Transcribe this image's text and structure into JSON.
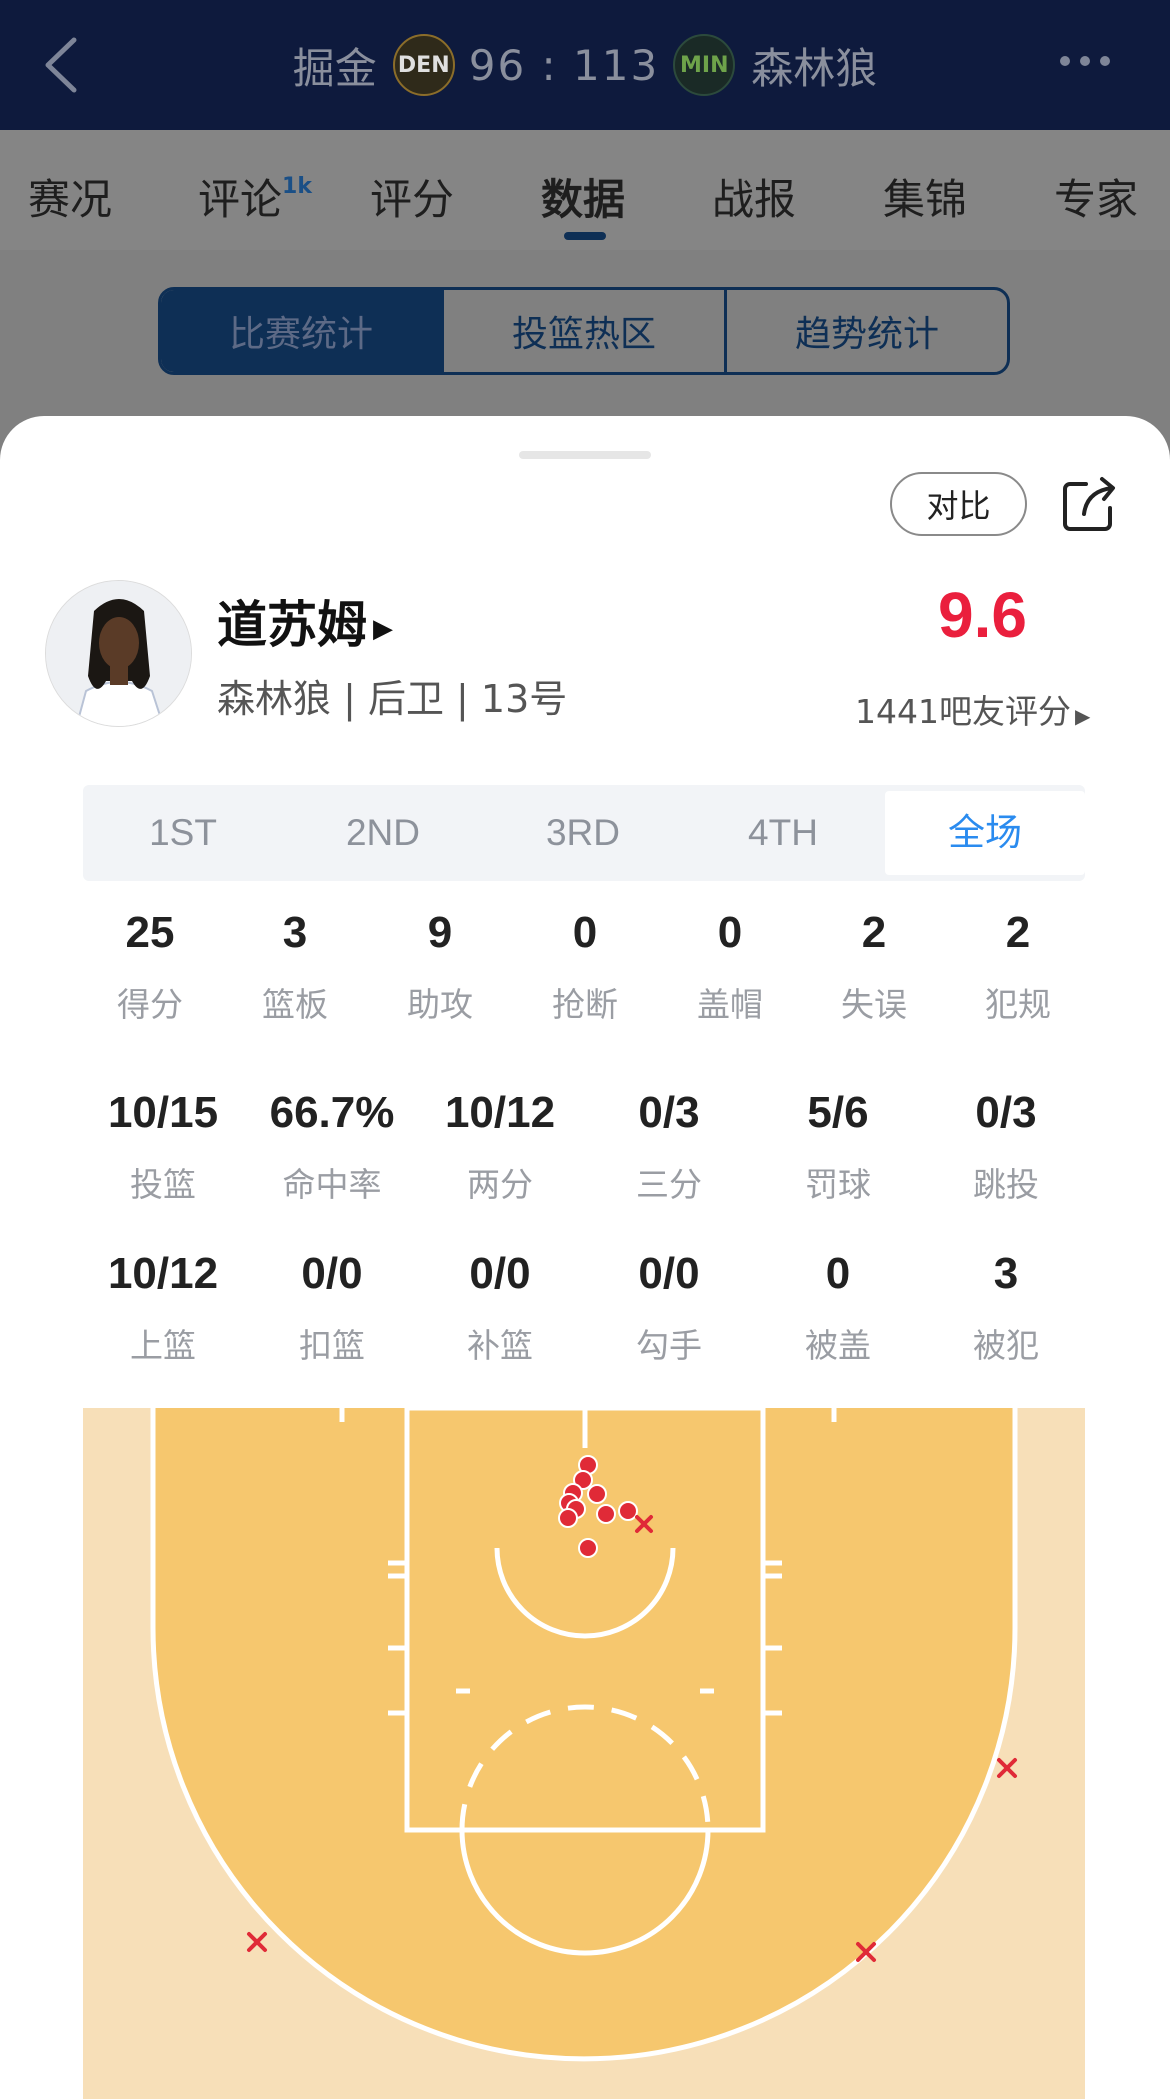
{
  "header": {
    "home_team": "掘金",
    "home_logo": "DEN",
    "score": "96 : 113",
    "away_logo": "MIN",
    "away_team": "森林狼"
  },
  "tabs": [
    {
      "label": "赛况"
    },
    {
      "label": "评论",
      "badge": "1k"
    },
    {
      "label": "评分"
    },
    {
      "label": "数据",
      "active": true
    },
    {
      "label": "战报"
    },
    {
      "label": "集锦"
    },
    {
      "label": "专家"
    }
  ],
  "segments": [
    "比赛统计",
    "投篮热区",
    "趋势统计"
  ],
  "sheet": {
    "compare_label": "对比",
    "player": {
      "name": "道苏姆",
      "info": "森林狼 | 后卫 | 13号",
      "rating": "9.6",
      "rating_count": "1441吧友评分"
    },
    "periods": [
      "1ST",
      "2ND",
      "3RD",
      "4TH",
      "全场"
    ],
    "active_period": "全场",
    "stats_row1": [
      {
        "value": "25",
        "label": "得分"
      },
      {
        "value": "3",
        "label": "篮板"
      },
      {
        "value": "9",
        "label": "助攻"
      },
      {
        "value": "0",
        "label": "抢断"
      },
      {
        "value": "0",
        "label": "盖帽"
      },
      {
        "value": "2",
        "label": "失误"
      },
      {
        "value": "2",
        "label": "犯规"
      }
    ],
    "stats_row2": [
      {
        "value": "10/15",
        "label": "投篮"
      },
      {
        "value": "66.7%",
        "label": "命中率"
      },
      {
        "value": "10/12",
        "label": "两分"
      },
      {
        "value": "0/3",
        "label": "三分"
      },
      {
        "value": "5/6",
        "label": "罚球"
      },
      {
        "value": "0/3",
        "label": "跳投"
      }
    ],
    "stats_row3": [
      {
        "value": "10/12",
        "label": "上篮"
      },
      {
        "value": "0/0",
        "label": "扣篮"
      },
      {
        "value": "0/0",
        "label": "补篮"
      },
      {
        "value": "0/0",
        "label": "勾手"
      },
      {
        "value": "0",
        "label": "被盖"
      },
      {
        "value": "3",
        "label": "被犯"
      }
    ]
  },
  "colors": {
    "header_bg": "#0e1a3d",
    "rating_red": "#ea1f3d",
    "active_blue": "#2a8bef",
    "court_paint": "#f6c76e",
    "court_outside": "#f7dfb8",
    "made_dot": "#e02a37",
    "miss_x": "#e02a37"
  }
}
